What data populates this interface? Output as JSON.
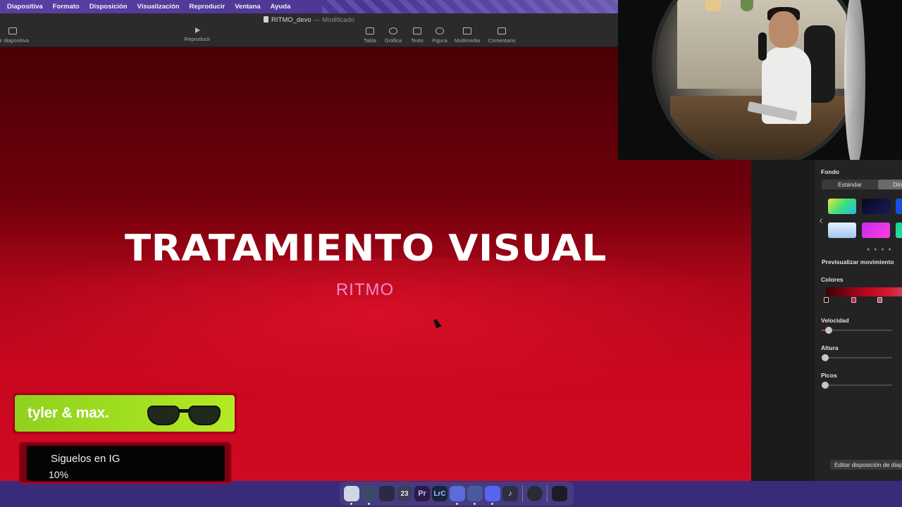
{
  "menubar": {
    "items": [
      "Diapositiva",
      "Formato",
      "Disposición",
      "Visualización",
      "Reproducir",
      "Ventana",
      "Ayuda"
    ]
  },
  "toolbar": {
    "doc_name": "RITMO_devo",
    "doc_status": "Modificado",
    "add_slide": "dir diapositiva",
    "play": "Reproducir",
    "table": "Tabla",
    "chart": "Gráfica",
    "text": "Texto",
    "shape": "Figura",
    "media": "Multimedia",
    "comment": "Comentario"
  },
  "slide": {
    "title": "TRATAMIENTO VISUAL",
    "subtitle": "RITMO"
  },
  "panel": {
    "section": "Fondo",
    "seg_a": "Estándar",
    "seg_b": "Diná",
    "preview": "Previsualizar movimiento",
    "colors": "Colores",
    "speed": "Velocidad",
    "height": "Altura",
    "peaks": "Picos",
    "edit_layout": "Editar disposición de diap",
    "speed_level": 0.05,
    "height_level": 0,
    "peaks_level": 0
  },
  "overlay": {
    "brand": "tyler & max.",
    "follow_title": "Siguelos en IG",
    "follow_progress": "10%"
  },
  "dock": {
    "calendar_day": "23",
    "premiere": "Pr",
    "lightroom": "LrC"
  },
  "colors": {
    "slide_red": "#cf0a22",
    "brand_green": "#a3e021",
    "accent_pink": "#f08ac8",
    "dock_purple": "#483c80"
  }
}
